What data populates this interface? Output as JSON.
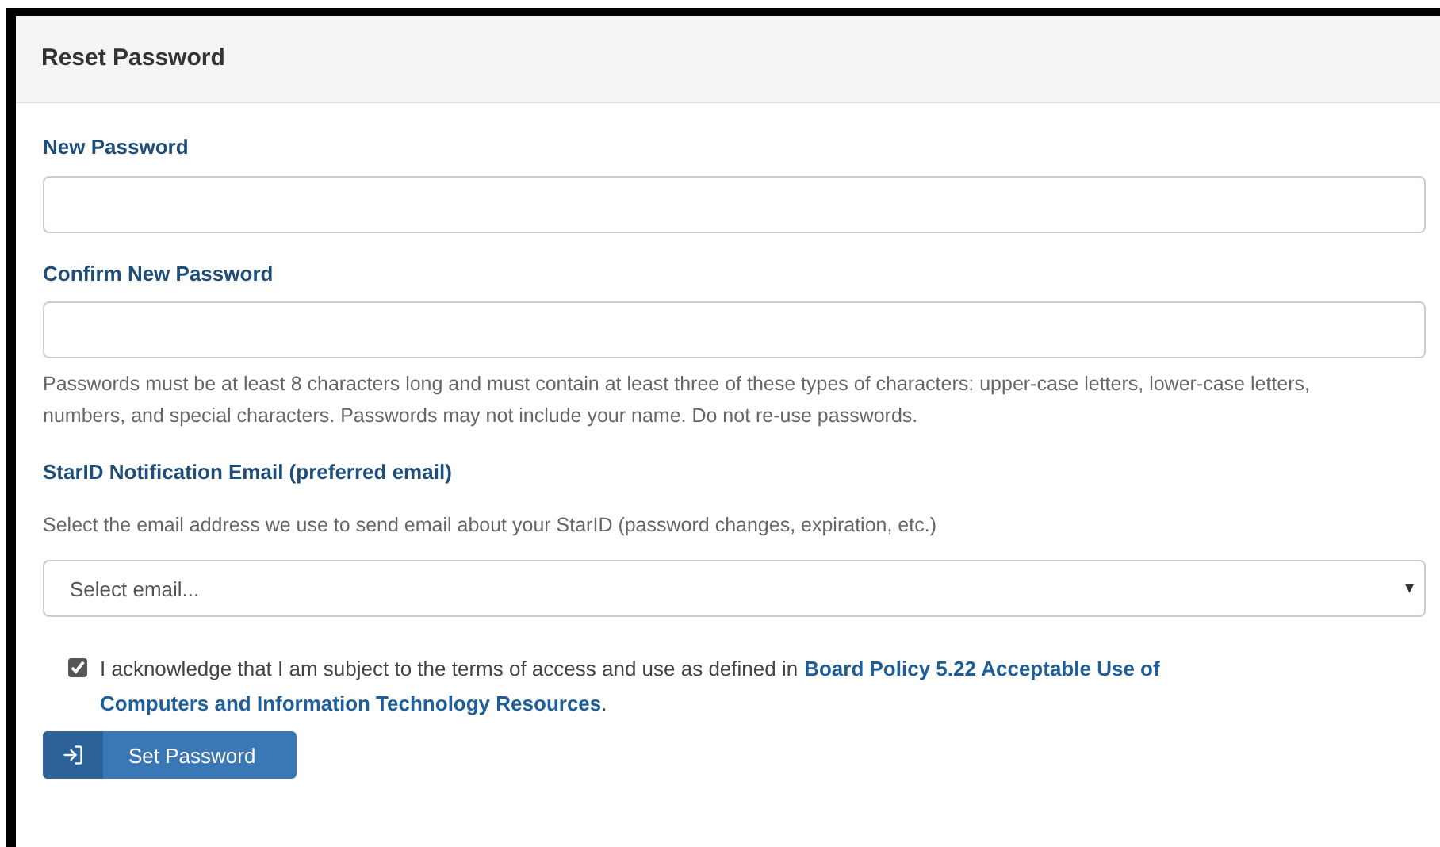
{
  "panel": {
    "title": "Reset Password"
  },
  "fields": [
    {
      "label": "New Password"
    },
    {
      "label": "Confirm New Password"
    }
  ],
  "help_text": "Passwords must be at least 8 characters long and must contain at least three of these types of characters: upper-case letters, lower-case letters, numbers, and special characters. Passwords may not include your name. Do not re-use passwords.",
  "email": {
    "label": "StarID Notification Email (preferred email)",
    "description": "Select the email address we use to send email about your StarID (password changes, expiration, etc.)",
    "placeholder": "Select email...",
    "caret": "▾"
  },
  "acknowledge": {
    "checked": true,
    "text": "I acknowledge that I am subject to the terms of access and use as defined in",
    "link_lines": [
      "Board Policy 5.22 Acceptable Use of",
      "Computers and Information Technology Resources"
    ],
    "end": "."
  },
  "submit_button": {
    "label": "Set Password"
  }
}
